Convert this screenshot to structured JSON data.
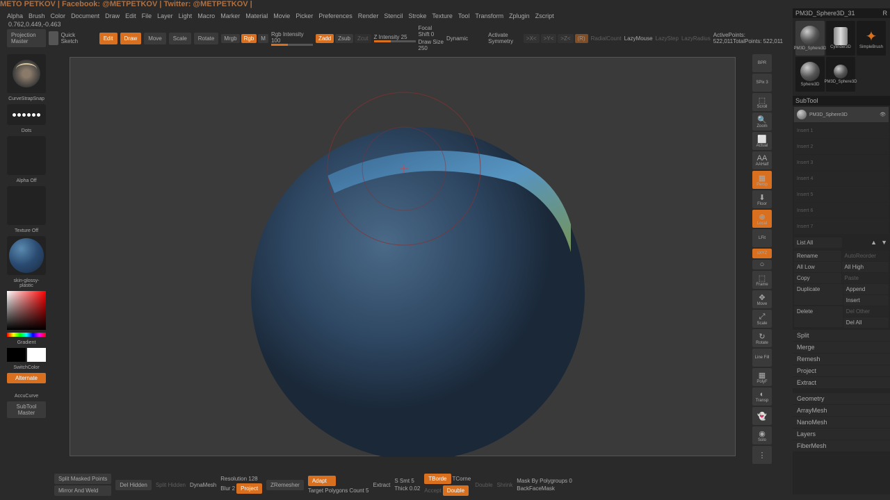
{
  "watermark": "METO PETKOV | Facebook: @METPETKOV | Twitter: @METPETKOV |",
  "coords": "0.762,0.449,-0.463",
  "menu": [
    "Alpha",
    "Brush",
    "Color",
    "Document",
    "Draw",
    "Edit",
    "File",
    "Layer",
    "Light",
    "Macro",
    "Marker",
    "Material",
    "Movie",
    "Picker",
    "Preferences",
    "Render",
    "Stencil",
    "Stroke",
    "Texture",
    "Tool",
    "Transform",
    "Zplugin",
    "Zscript"
  ],
  "topshelf": {
    "projection": "Projection\nMaster",
    "quick": "Quick\nSketch",
    "edit": "Edit",
    "draw": "Draw",
    "move": "Move",
    "scale": "Scale",
    "rotate": "Rotate",
    "mrgb": "Mrgb",
    "rgb": "Rgb",
    "m": "M",
    "rgb_int": "Rgb Intensity 100",
    "zadd": "Zadd",
    "zsub": "Zsub",
    "zcut": "Zcut",
    "z_int": "Z Intensity 25",
    "focal": "Focal Shift 0",
    "drawsize": "Draw Size 250",
    "dynamic": "Dynamic",
    "activate": "Activate Symmetry",
    "x": ">X<",
    "y": ">Y<",
    "z": ">Z<",
    "r": "(R)",
    "radial": "RadialCount",
    "lazy": "LazyMouse",
    "lazystep": "LazyStep",
    "lazyradius": "LazyRadius",
    "points": "ActivePoints: 522,011TotalPoints: 522,011"
  },
  "left": {
    "brush": "CurveStrapSnap",
    "stroke": "Dots",
    "alpha": "Alpha Off",
    "texture": "Texture Off",
    "material": "skin-glossy-plastic",
    "gradient": "Gradient",
    "switch": "SwitchColor",
    "alternate": "Alternate",
    "accu": "AccuCurve",
    "subtool": "SubTool\nMaster"
  },
  "right_tools": [
    "BPR",
    "SPix 3",
    "Scroll",
    "Zoom",
    "Actual",
    "AAHalf",
    "Persp",
    "Floor",
    "Local",
    "LFit",
    "sXYZ",
    "Frame",
    "Move",
    "Scale",
    "Rotate",
    "Line Fill",
    "PolyF",
    "Transp",
    "",
    "Solo",
    ""
  ],
  "right_panel": {
    "header": "PM3D_Sphere3D_31",
    "r": "R",
    "tools": [
      "PM3D_Sphere3D",
      "Cylinder3D",
      "SimpleBrush",
      "Sphere3D",
      "PM3D_Sphere3D"
    ],
    "subtool_hdr": "SubTool",
    "subtools": [
      "PM3D_Sphere3D",
      "Insert 1",
      "Insert 2",
      "Insert 3",
      "Insert 4",
      "Insert 5",
      "Insert 6",
      "Insert 7"
    ],
    "list_all": "List All",
    "btns": {
      "rename": "Rename",
      "auto": "AutoReorder",
      "alllow": "All Low",
      "allhigh": "All High",
      "copy": "Copy",
      "paste": "Paste",
      "duplicate": "Duplicate",
      "append": "Append",
      "insert": "Insert",
      "delete": "Delete",
      "delother": "Del Other",
      "delall": "Del All"
    },
    "accordions": [
      "Split",
      "Merge",
      "Remesh",
      "Project",
      "Extract",
      "Geometry",
      "ArrayMesh",
      "NanoMesh",
      "Layers",
      "FiberMesh"
    ]
  },
  "bottom": {
    "split_masked": "Split Masked Points",
    "del_hidden": "Del Hidden",
    "split_hidden": "Split Hidden",
    "mirror": "Mirror And Weld",
    "dynamesh": "DynaMesh",
    "resolution": "Resolution 128",
    "blur": "Blur 2",
    "project": "Project",
    "zremesher": "ZRemesher",
    "adapt": "Adapt",
    "target": "Target Polygons Count 5",
    "extract": "Extract",
    "ssmt": "S Smt 5",
    "tborde": "TBorde",
    "tcorne": "TCorne",
    "thick": "Thick 0.02",
    "accept": "Accept",
    "double": "Double",
    "shrink": "Shrink",
    "mask": "Mask By Polygroups 0",
    "backface": "BackFaceMask"
  }
}
